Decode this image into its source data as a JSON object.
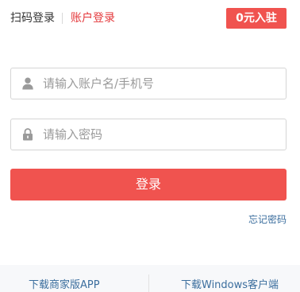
{
  "header": {
    "tabs": [
      {
        "label": "扫码登录",
        "active": false
      },
      {
        "label": "账户登录",
        "active": true
      }
    ],
    "join_label": "0元入驻"
  },
  "form": {
    "username": {
      "placeholder": "请输入账户名/手机号",
      "value": "",
      "icon": "user-icon"
    },
    "password": {
      "placeholder": "请输入密码",
      "value": "",
      "icon": "lock-icon"
    },
    "login_label": "登录",
    "forgot_label": "忘记密码"
  },
  "footer": {
    "links": [
      {
        "label": "下载商家版APP"
      },
      {
        "label": "下载Windows客户端"
      }
    ]
  },
  "colors": {
    "accent": "#f0534f",
    "active_tab": "#e4393c",
    "link": "#3b6e9e",
    "placeholder": "#9a9a9a",
    "footer_bg": "#f7f8fa"
  }
}
